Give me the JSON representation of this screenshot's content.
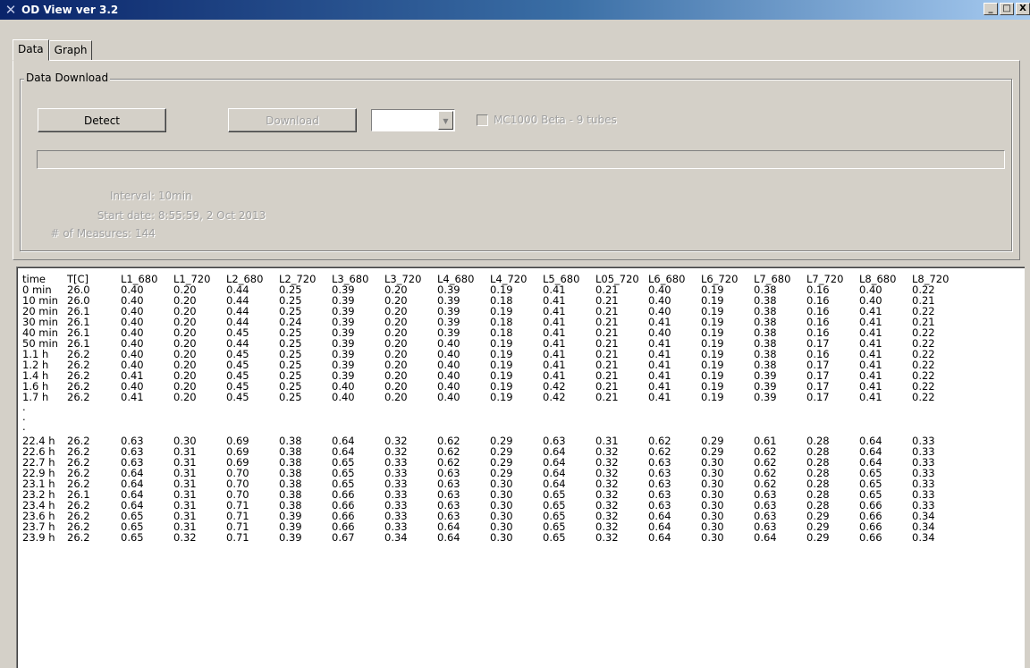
{
  "window": {
    "title": "OD View ver 3.2",
    "icon": "x-app-icon",
    "controls": [
      "_",
      "□",
      "X"
    ]
  },
  "tabs": [
    {
      "label": "Data",
      "active": true
    },
    {
      "label": "Graph",
      "active": false
    }
  ],
  "download": {
    "group_label": "Data Download",
    "detect_label": "Detect",
    "download_label": "Download",
    "combo_value": "",
    "checkbox_label": "MC1000 Beta - 9 tubes",
    "checkbox_checked": false,
    "progress": 0,
    "interval_label": "Interval:",
    "interval_value": "10min",
    "start_label": "Start date:",
    "start_value": "8:55:59,  2 Oct 2013",
    "measures_label": "# of Measures:",
    "measures_value": "144"
  },
  "table": {
    "headers": [
      "time",
      "T[C]",
      "L1_680",
      "L1_720",
      "L2_680",
      "L2_720",
      "L3_680",
      "L3_720",
      "L4_680",
      "L4_720",
      "L5_680",
      "L05_720",
      "L6_680",
      "L6_720",
      "L7_680",
      "L7_720",
      "L8_680",
      "L8_720"
    ],
    "rows_top": [
      [
        "0 min",
        "26.0",
        "0.40",
        "0.20",
        "0.44",
        "0.25",
        "0.39",
        "0.20",
        "0.39",
        "0.19",
        "0.41",
        "0.21",
        "0.40",
        "0.19",
        "0.38",
        "0.16",
        "0.40",
        "0.22"
      ],
      [
        "10 min",
        "26.0",
        "0.40",
        "0.20",
        "0.44",
        "0.25",
        "0.39",
        "0.20",
        "0.39",
        "0.18",
        "0.41",
        "0.21",
        "0.40",
        "0.19",
        "0.38",
        "0.16",
        "0.40",
        "0.21"
      ],
      [
        "20 min",
        "26.1",
        "0.40",
        "0.20",
        "0.44",
        "0.25",
        "0.39",
        "0.20",
        "0.39",
        "0.19",
        "0.41",
        "0.21",
        "0.40",
        "0.19",
        "0.38",
        "0.16",
        "0.41",
        "0.22"
      ],
      [
        "30 min",
        "26.1",
        "0.40",
        "0.20",
        "0.44",
        "0.24",
        "0.39",
        "0.20",
        "0.39",
        "0.18",
        "0.41",
        "0.21",
        "0.41",
        "0.19",
        "0.38",
        "0.16",
        "0.41",
        "0.21"
      ],
      [
        "40 min",
        "26.1",
        "0.40",
        "0.20",
        "0.45",
        "0.25",
        "0.39",
        "0.20",
        "0.39",
        "0.18",
        "0.41",
        "0.21",
        "0.40",
        "0.19",
        "0.38",
        "0.16",
        "0.41",
        "0.22"
      ],
      [
        "50 min",
        "26.1",
        "0.40",
        "0.20",
        "0.44",
        "0.25",
        "0.39",
        "0.20",
        "0.40",
        "0.19",
        "0.41",
        "0.21",
        "0.41",
        "0.19",
        "0.38",
        "0.17",
        "0.41",
        "0.22"
      ],
      [
        "1.1 h",
        "26.2",
        "0.40",
        "0.20",
        "0.45",
        "0.25",
        "0.39",
        "0.20",
        "0.40",
        "0.19",
        "0.41",
        "0.21",
        "0.41",
        "0.19",
        "0.38",
        "0.16",
        "0.41",
        "0.22"
      ],
      [
        "1.2 h",
        "26.2",
        "0.40",
        "0.20",
        "0.45",
        "0.25",
        "0.39",
        "0.20",
        "0.40",
        "0.19",
        "0.41",
        "0.21",
        "0.41",
        "0.19",
        "0.38",
        "0.17",
        "0.41",
        "0.22"
      ],
      [
        "1.4 h",
        "26.2",
        "0.41",
        "0.20",
        "0.45",
        "0.25",
        "0.39",
        "0.20",
        "0.40",
        "0.19",
        "0.41",
        "0.21",
        "0.41",
        "0.19",
        "0.39",
        "0.17",
        "0.41",
        "0.22"
      ],
      [
        "1.6 h",
        "26.2",
        "0.40",
        "0.20",
        "0.45",
        "0.25",
        "0.40",
        "0.20",
        "0.40",
        "0.19",
        "0.42",
        "0.21",
        "0.41",
        "0.19",
        "0.39",
        "0.17",
        "0.41",
        "0.22"
      ],
      [
        "1.7 h",
        "26.2",
        "0.41",
        "0.20",
        "0.45",
        "0.25",
        "0.40",
        "0.20",
        "0.40",
        "0.19",
        "0.42",
        "0.21",
        "0.41",
        "0.19",
        "0.39",
        "0.17",
        "0.41",
        "0.22"
      ]
    ],
    "ellipsis": [
      ".",
      ".",
      "."
    ],
    "rows_bottom": [
      [
        "22.4 h",
        "26.2",
        "0.63",
        "0.30",
        "0.69",
        "0.38",
        "0.64",
        "0.32",
        "0.62",
        "0.29",
        "0.63",
        "0.31",
        "0.62",
        "0.29",
        "0.61",
        "0.28",
        "0.64",
        "0.33"
      ],
      [
        "22.6 h",
        "26.2",
        "0.63",
        "0.31",
        "0.69",
        "0.38",
        "0.64",
        "0.32",
        "0.62",
        "0.29",
        "0.64",
        "0.32",
        "0.62",
        "0.29",
        "0.62",
        "0.28",
        "0.64",
        "0.33"
      ],
      [
        "22.7 h",
        "26.2",
        "0.63",
        "0.31",
        "0.69",
        "0.38",
        "0.65",
        "0.33",
        "0.62",
        "0.29",
        "0.64",
        "0.32",
        "0.63",
        "0.30",
        "0.62",
        "0.28",
        "0.64",
        "0.33"
      ],
      [
        "22.9 h",
        "26.2",
        "0.64",
        "0.31",
        "0.70",
        "0.38",
        "0.65",
        "0.33",
        "0.63",
        "0.29",
        "0.64",
        "0.32",
        "0.63",
        "0.30",
        "0.62",
        "0.28",
        "0.65",
        "0.33"
      ],
      [
        "23.1 h",
        "26.2",
        "0.64",
        "0.31",
        "0.70",
        "0.38",
        "0.65",
        "0.33",
        "0.63",
        "0.30",
        "0.64",
        "0.32",
        "0.63",
        "0.30",
        "0.62",
        "0.28",
        "0.65",
        "0.33"
      ],
      [
        "23.2 h",
        "26.1",
        "0.64",
        "0.31",
        "0.70",
        "0.38",
        "0.66",
        "0.33",
        "0.63",
        "0.30",
        "0.65",
        "0.32",
        "0.63",
        "0.30",
        "0.63",
        "0.28",
        "0.65",
        "0.33"
      ],
      [
        "23.4 h",
        "26.2",
        "0.64",
        "0.31",
        "0.71",
        "0.38",
        "0.66",
        "0.33",
        "0.63",
        "0.30",
        "0.65",
        "0.32",
        "0.63",
        "0.30",
        "0.63",
        "0.28",
        "0.66",
        "0.33"
      ],
      [
        "23.6 h",
        "26.2",
        "0.65",
        "0.31",
        "0.71",
        "0.39",
        "0.66",
        "0.33",
        "0.63",
        "0.30",
        "0.65",
        "0.32",
        "0.64",
        "0.30",
        "0.63",
        "0.29",
        "0.66",
        "0.34"
      ],
      [
        "23.7 h",
        "26.2",
        "0.65",
        "0.31",
        "0.71",
        "0.39",
        "0.66",
        "0.33",
        "0.64",
        "0.30",
        "0.65",
        "0.32",
        "0.64",
        "0.30",
        "0.63",
        "0.29",
        "0.66",
        "0.34"
      ],
      [
        "23.9 h",
        "26.2",
        "0.65",
        "0.32",
        "0.71",
        "0.39",
        "0.67",
        "0.34",
        "0.64",
        "0.30",
        "0.65",
        "0.32",
        "0.64",
        "0.30",
        "0.64",
        "0.29",
        "0.66",
        "0.34"
      ]
    ]
  }
}
